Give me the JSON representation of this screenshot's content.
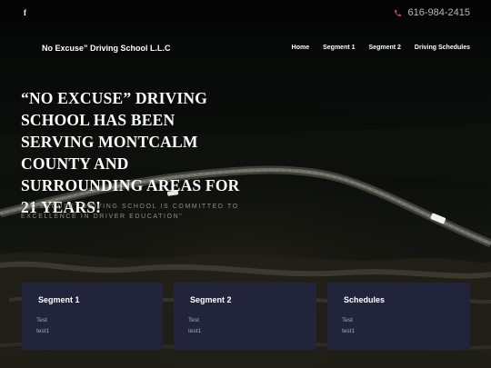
{
  "topbar": {
    "social": "f",
    "phone": "616-984-2415"
  },
  "nav": {
    "brand": "No Excuse” Driving School L.L.C",
    "items": [
      "Home",
      "Segment 1",
      "Segment 2",
      "Driving Schedules"
    ]
  },
  "hero": {
    "headline": "“NO EXCUSE” DRIVING SCHOOL HAS BEEN SERVING MONTCALM COUNTY AND SURROUNDING AREAS FOR 21 YEARS!",
    "subtext": "“NO EXCUSE” DRIVING SCHOOL IS COMMITTED TO EXCELLENCE IN DRIVER EDUCATION”"
  },
  "cards": [
    {
      "title": "Segment 1",
      "line1": "Test",
      "line2": "test1"
    },
    {
      "title": "Segment 2",
      "line1": "Test",
      "line2": "test1"
    },
    {
      "title": "Schedules",
      "line1": "Test",
      "line2": "test1"
    }
  ],
  "colors": {
    "topbar": "#050505",
    "card_bg": "#22243c",
    "phone_icon": "#d9534f"
  },
  "icons": [
    "facebook-icon",
    "phone-icon"
  ]
}
